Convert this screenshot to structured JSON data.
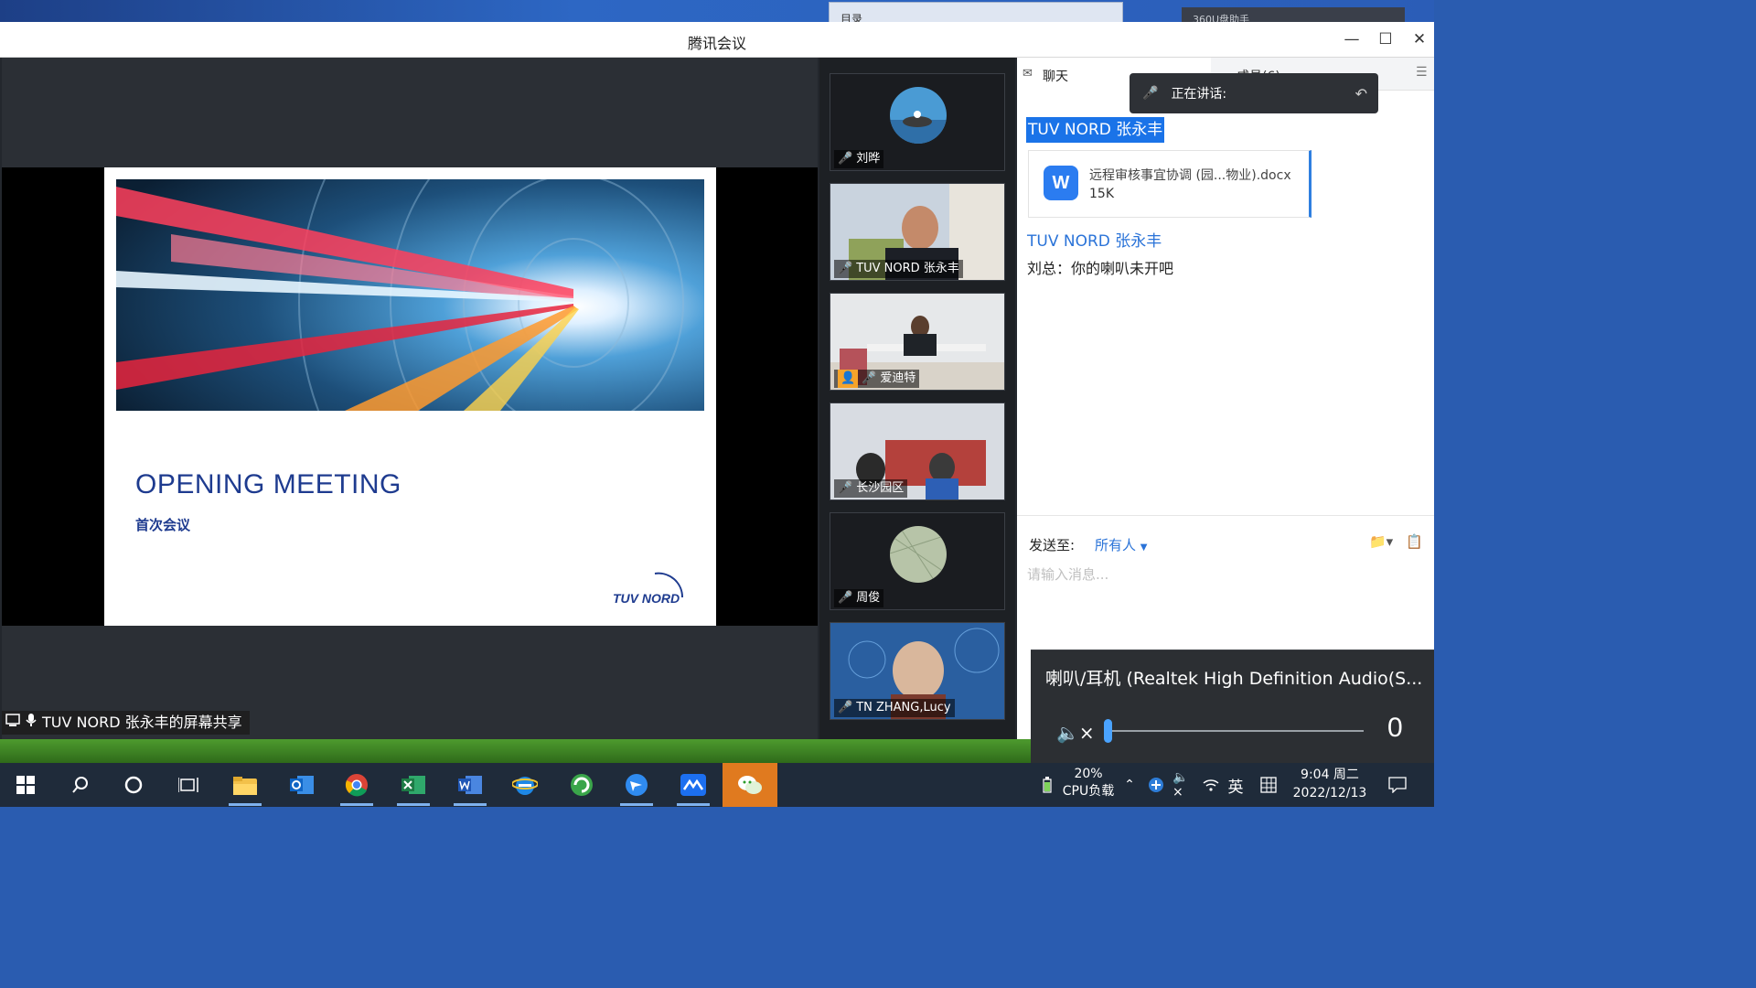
{
  "background_windows": {
    "left_window_title": "目录",
    "right_window_title": "360U盘助手"
  },
  "window": {
    "title": "腾讯会议",
    "minimize_icon": "minimize-icon",
    "maximize_icon": "maximize-icon",
    "close_icon": "close-icon"
  },
  "screen_share": {
    "slide_title": "OPENING MEETING",
    "slide_subtitle": "首次会议",
    "logo_text": "TUV NORD",
    "label": "TUV NORD 张永丰的屏幕共享"
  },
  "participants": [
    {
      "name": "刘晔",
      "mic": "on"
    },
    {
      "name": "TUV NORD 张永丰",
      "mic": "on"
    },
    {
      "name": "爱迪特",
      "mic": "muted"
    },
    {
      "name": "长沙园区",
      "mic": "on"
    },
    {
      "name": "周俊",
      "mic": "muted"
    },
    {
      "name": "TN ZHANG,Lucy",
      "mic": "on"
    }
  ],
  "chat": {
    "tab_chat": "聊天",
    "tab_members": "成员(6)",
    "speaking_label": "正在讲话:",
    "messages": [
      {
        "sender": "TUV NORD 张永丰",
        "file_icon_letter": "W",
        "file_name": "远程审核事宜协调 (园...物业).docx",
        "file_size": "15K"
      },
      {
        "sender": "TUV NORD 张永丰",
        "text": "刘总：你的喇叭未开吧"
      }
    ],
    "send_to_label": "发送至:",
    "send_to_value": "所有人",
    "input_placeholder": "请输入消息..."
  },
  "volume_popup": {
    "device": "喇叭/耳机 (Realtek High Definition Audio(S...",
    "level": "0",
    "level_fraction": 0.0
  },
  "taskbar": {
    "apps": [
      "windows-start",
      "search",
      "cortana",
      "task-view",
      "file-explorer",
      "outlook",
      "chrome",
      "excel",
      "word",
      "internet-explorer",
      "360-browser",
      "feishu",
      "tencent-meeting",
      "wechat"
    ],
    "cpu_percent": "20%",
    "cpu_label": "CPU负载",
    "ime_lang": "英",
    "time": "9:04 周二",
    "date": "2022/12/13"
  }
}
